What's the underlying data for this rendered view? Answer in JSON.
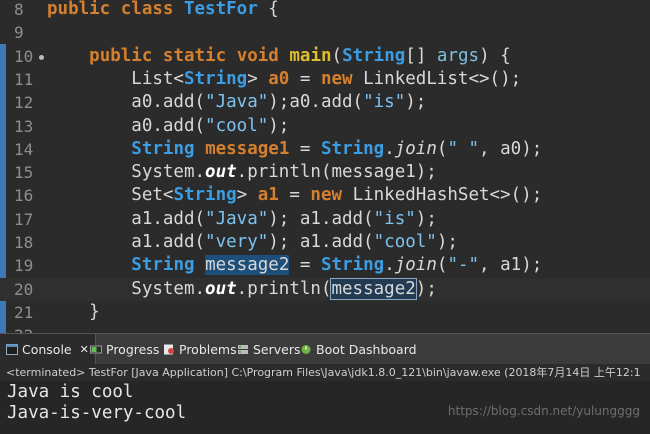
{
  "editor": {
    "lines": [
      {
        "num": "8",
        "tokens": [
          {
            "c": "kw",
            "t": "public "
          },
          {
            "c": "kw",
            "t": "class "
          },
          {
            "c": "typ",
            "t": "TestFor"
          },
          {
            "c": "pl",
            "t": " {"
          }
        ]
      },
      {
        "num": "9",
        "tokens": []
      },
      {
        "num": "10",
        "tokens": [
          {
            "c": "pl",
            "t": "    "
          },
          {
            "c": "kw",
            "t": "public "
          },
          {
            "c": "kw",
            "t": "static "
          },
          {
            "c": "kw",
            "t": "void "
          },
          {
            "c": "fn",
            "t": "main"
          },
          {
            "c": "pl",
            "t": "("
          },
          {
            "c": "typ",
            "t": "String"
          },
          {
            "c": "pl",
            "t": "[] "
          },
          {
            "c": "par",
            "t": "args"
          },
          {
            "c": "pl",
            "t": ") {"
          }
        ]
      },
      {
        "num": "11",
        "tokens": [
          {
            "c": "pl",
            "t": "        List<"
          },
          {
            "c": "typ",
            "t": "String"
          },
          {
            "c": "pl",
            "t": "> "
          },
          {
            "c": "var",
            "t": "a0"
          },
          {
            "c": "pl",
            "t": " = "
          },
          {
            "c": "kw",
            "t": "new "
          },
          {
            "c": "pl",
            "t": "LinkedList<>();"
          }
        ]
      },
      {
        "num": "12",
        "tokens": [
          {
            "c": "pl",
            "t": "        a0.add("
          },
          {
            "c": "str",
            "t": "\"Java\""
          },
          {
            "c": "pl",
            "t": ");a0.add("
          },
          {
            "c": "str",
            "t": "\"is\""
          },
          {
            "c": "pl",
            "t": ");"
          }
        ]
      },
      {
        "num": "13",
        "tokens": [
          {
            "c": "pl",
            "t": "        a0.add("
          },
          {
            "c": "str",
            "t": "\"cool\""
          },
          {
            "c": "pl",
            "t": ");"
          }
        ]
      },
      {
        "num": "14",
        "tokens": [
          {
            "c": "pl",
            "t": "        "
          },
          {
            "c": "typ",
            "t": "String "
          },
          {
            "c": "var",
            "t": "message1"
          },
          {
            "c": "pl",
            "t": " = "
          },
          {
            "c": "typ",
            "t": "String"
          },
          {
            "c": "pl",
            "t": "."
          },
          {
            "c": "it",
            "t": "join"
          },
          {
            "c": "pl",
            "t": "("
          },
          {
            "c": "str",
            "t": "\" \""
          },
          {
            "c": "pl",
            "t": ", a0);"
          }
        ]
      },
      {
        "num": "15",
        "tokens": [
          {
            "c": "pl",
            "t": "        System."
          },
          {
            "c": "fld",
            "t": "out"
          },
          {
            "c": "pl",
            "t": ".println(message1);"
          }
        ]
      },
      {
        "num": "16",
        "tokens": [
          {
            "c": "pl",
            "t": "        Set<"
          },
          {
            "c": "typ",
            "t": "String"
          },
          {
            "c": "pl",
            "t": "> "
          },
          {
            "c": "var",
            "t": "a1"
          },
          {
            "c": "pl",
            "t": " = "
          },
          {
            "c": "kw",
            "t": "new "
          },
          {
            "c": "pl",
            "t": "LinkedHashSet<>();"
          }
        ]
      },
      {
        "num": "17",
        "tokens": [
          {
            "c": "pl",
            "t": "        a1.add("
          },
          {
            "c": "str",
            "t": "\"Java\""
          },
          {
            "c": "pl",
            "t": "); a1.add("
          },
          {
            "c": "str",
            "t": "\"is\""
          },
          {
            "c": "pl",
            "t": ");"
          }
        ]
      },
      {
        "num": "18",
        "tokens": [
          {
            "c": "pl",
            "t": "        a1.add("
          },
          {
            "c": "str",
            "t": "\"very\""
          },
          {
            "c": "pl",
            "t": "); a1.add("
          },
          {
            "c": "str",
            "t": "\"cool\""
          },
          {
            "c": "pl",
            "t": ");"
          }
        ]
      },
      {
        "num": "19",
        "tokens": [
          {
            "c": "pl",
            "t": "        "
          },
          {
            "c": "typ",
            "t": "String "
          },
          {
            "c": "var hl",
            "t": "message2"
          },
          {
            "c": "pl",
            "t": " = "
          },
          {
            "c": "typ",
            "t": "String"
          },
          {
            "c": "pl",
            "t": "."
          },
          {
            "c": "it",
            "t": "join"
          },
          {
            "c": "pl",
            "t": "("
          },
          {
            "c": "str",
            "t": "\"-\""
          },
          {
            "c": "pl",
            "t": ", a1);"
          }
        ]
      },
      {
        "num": "20",
        "tokens": [
          {
            "c": "pl",
            "t": "        System."
          },
          {
            "c": "fld",
            "t": "out"
          },
          {
            "c": "pl",
            "t": ".println("
          },
          {
            "c": "pl hlbox",
            "t": "message2"
          },
          {
            "c": "pl",
            "t": ");"
          }
        ]
      },
      {
        "num": "21",
        "tokens": [
          {
            "c": "pl",
            "t": "    }"
          }
        ]
      },
      {
        "num": "22",
        "tokens": []
      }
    ]
  },
  "tabs": {
    "console": "Console",
    "console_close": "✕",
    "progress": "Progress",
    "problems": "Problems",
    "servers": "Servers",
    "boot": "Boot Dashboard"
  },
  "status": "<terminated> TestFor [Java Application] C:\\Program Files\\Java\\jdk1.8.0_121\\bin\\javaw.exe (2018年7月14日 上午12:1",
  "console_output": [
    "Java is cool",
    "Java-is-very-cool"
  ],
  "watermark": "https://blog.csdn.net/yulungggg"
}
